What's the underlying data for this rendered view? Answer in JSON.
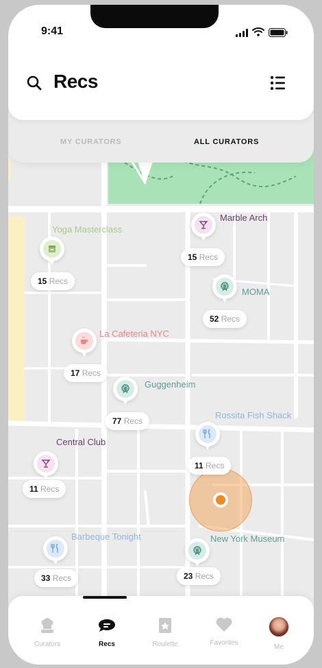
{
  "status_bar": {
    "time": "9:41"
  },
  "header": {
    "title": "Recs"
  },
  "tabs": [
    {
      "label": "MY CURATORS",
      "active": false
    },
    {
      "label": "ALL CURATORS",
      "active": true
    }
  ],
  "places": [
    {
      "name": "Marble Arch",
      "count": "15",
      "icon": "cocktail-icon",
      "color": "#6a3f6a"
    },
    {
      "name": "Yoga Masterclass",
      "count": "15",
      "icon": "store-icon",
      "color": "#a9c98a"
    },
    {
      "name": "MOMA",
      "count": "52",
      "icon": "ferris-wheel-icon",
      "color": "#5f9e93"
    },
    {
      "name": "La Cafeteria NYC",
      "count": "17",
      "icon": "coffee-icon",
      "color": "#e58a87"
    },
    {
      "name": "Guggenheim",
      "count": "77",
      "icon": "ferris-wheel-icon",
      "color": "#5f9e93"
    },
    {
      "name": "Rossita Fish Shack",
      "count": "11",
      "icon": "fork-knife-icon",
      "color": "#8fb7e4"
    },
    {
      "name": "Central Club",
      "count": "11",
      "icon": "cocktail-icon",
      "color": "#6a3f6a"
    },
    {
      "name": "Barbeque Tonight",
      "count": "33",
      "icon": "fork-knife-icon",
      "color": "#8fb7e4"
    },
    {
      "name": "New York Museum",
      "count": "23",
      "icon": "ferris-wheel-icon",
      "color": "#5f9e93"
    }
  ],
  "recs_suffix": "Recs",
  "tabbar": [
    {
      "label": "Curators",
      "icon": "chef-hat-icon",
      "active": false
    },
    {
      "label": "Recs",
      "icon": "chat-bubble-icon",
      "active": true
    },
    {
      "label": "Roulette",
      "icon": "roulette-card-icon",
      "active": false
    },
    {
      "label": "Favorites",
      "icon": "heart-icon",
      "active": false
    },
    {
      "label": "Me",
      "icon": "avatar-icon",
      "active": false
    }
  ]
}
